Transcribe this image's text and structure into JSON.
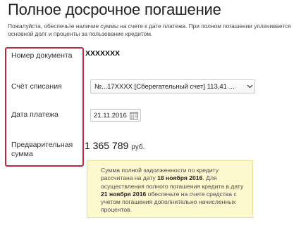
{
  "page": {
    "title": "Полное досрочное погашение",
    "subtitle": "Пожалуйста, обеспечьте наличие суммы на счете к дате платежа. При полном погашении уплачивается\nосновной долг и проценты за пользование кредитом."
  },
  "form": {
    "document_number": {
      "label": "Номер документа",
      "value": "XXXXXXX"
    },
    "debit_account": {
      "label": "Счёт списания",
      "value": "№...17XXXX [Сберегательный счет] 113,41 ..."
    },
    "payment_date": {
      "label": "Дата платежа",
      "value": "21.11.2016"
    },
    "preliminary_amount": {
      "label": "Предварительная сумма",
      "value": "1 365 789",
      "currency": "руб."
    }
  },
  "notice": {
    "text_1": "Сумма полной задолженности по кредиту рассчитана на дату ",
    "date_1": "18 ноября 2016",
    "text_2": ". Для осуществления полного погашения кредита в дату ",
    "date_2": "21 ноября 2016",
    "text_3": " обеспечьте на счете средства с учетом погашения дополнительно начисленных процентов."
  },
  "colors": {
    "highlight_border": "#c2273b",
    "notice_background": "#fdf9cf",
    "notice_border": "#ece09a"
  },
  "icons": {
    "select_arrow": "chevron-down-icon",
    "date_picker": "calendar-icon"
  }
}
